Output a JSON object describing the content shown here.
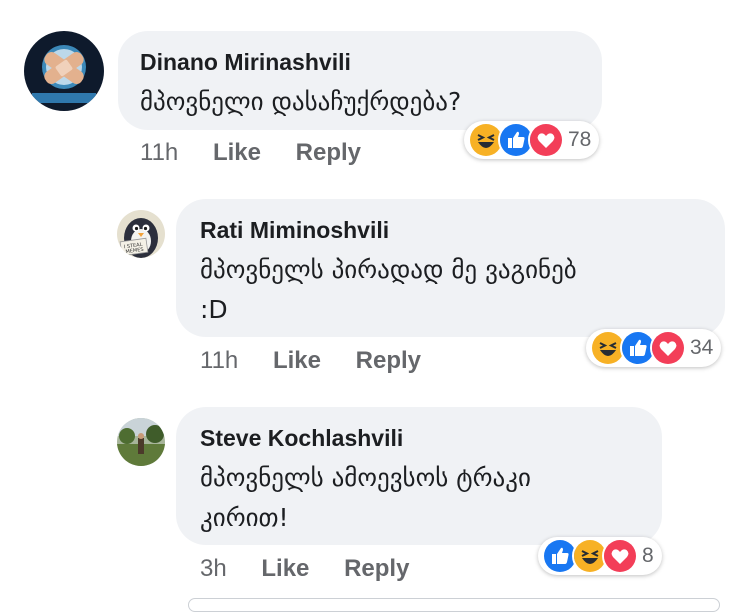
{
  "comments": [
    {
      "author": "Dinano Mirinashvili",
      "text": "მპოვნელი დასაჩუქრდება?",
      "time": "11h",
      "like_label": "Like",
      "reply_label": "Reply",
      "reactions": [
        "haha",
        "like",
        "love"
      ],
      "reaction_count": "78"
    },
    {
      "author": "Rati Miminoshvili",
      "text": "მპოვნელს პირადად მე ვაგინებ\n:D",
      "time": "11h",
      "like_label": "Like",
      "reply_label": "Reply",
      "avatar_sign": "I STEAL\nMEMES",
      "reactions": [
        "haha",
        "like",
        "love"
      ],
      "reaction_count": "34"
    },
    {
      "author": "Steve Kochlashvili",
      "text": "მპოვნელს ამოევსოს ტრაკი\nკირით!",
      "time": "3h",
      "like_label": "Like",
      "reply_label": "Reply",
      "reactions": [
        "like",
        "haha",
        "love"
      ],
      "reaction_count": "8"
    }
  ],
  "colors": {
    "bubble": "#f0f2f5",
    "meta_text": "#65676b",
    "like_blue": "#1877f2",
    "love_red": "#f33e58",
    "haha_yellow": "#f7b125"
  }
}
